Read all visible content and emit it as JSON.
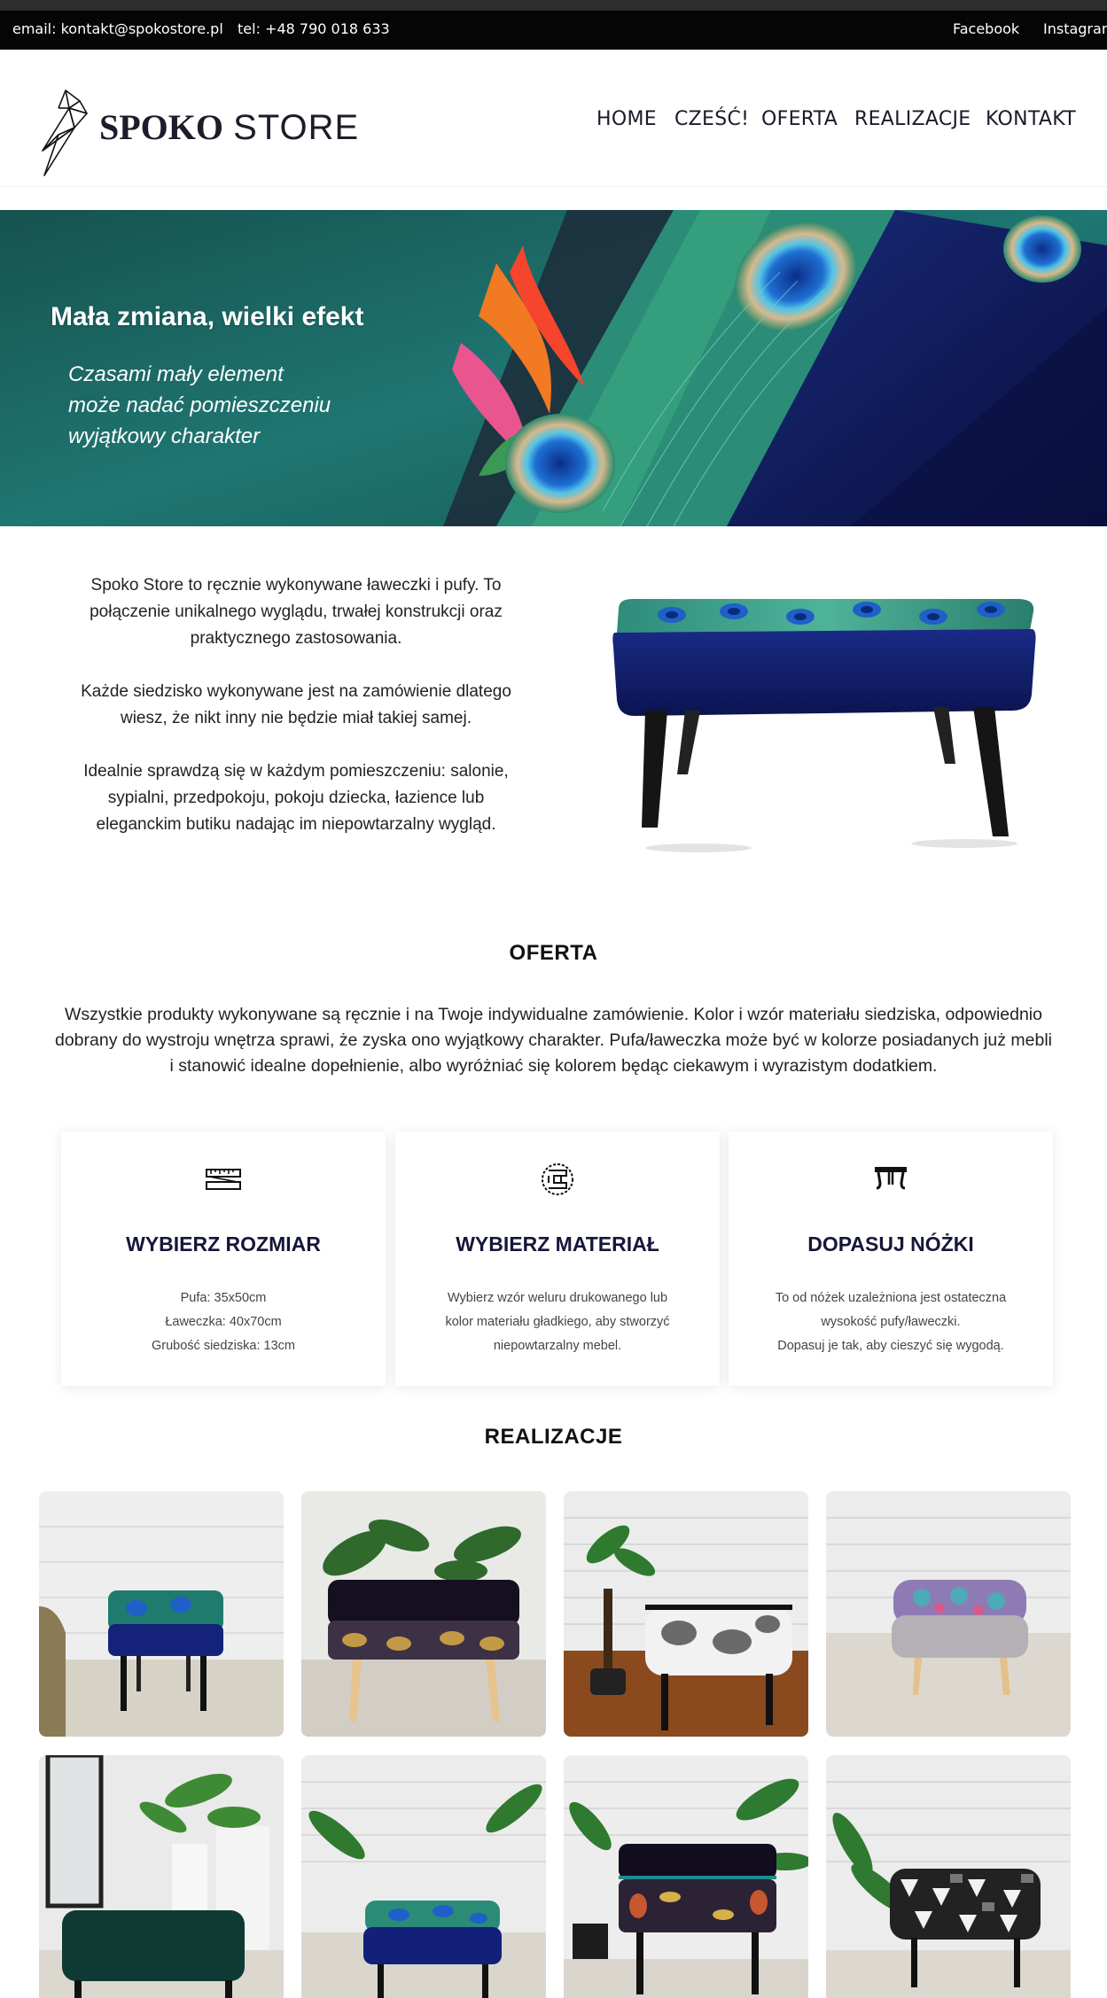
{
  "topbar": {
    "email": "email: kontakt@spokostore.pl",
    "phone": "tel: +48 790 018 633",
    "facebook": "Facebook",
    "instagram": "Instagram"
  },
  "header": {
    "logo_bold": "SPOKO",
    "logo_light": "STORE",
    "nav": [
      "HOME",
      "CZEŚĆ!",
      "OFERTA",
      "REALIZACJE",
      "KONTAKT"
    ]
  },
  "hero": {
    "title": "Mała zmiana, wielki efekt",
    "subtitle_lines": [
      "Czasami mały element",
      "może nadać pomieszczeniu",
      "wyjątkowy charakter"
    ]
  },
  "intro": {
    "paragraphs": [
      "Spoko Store to ręcznie wykonywane ławeczki i pufy. To połączenie unikalnego wyglądu, trwałej konstrukcji oraz praktycznego zastosowania.",
      "Każde siedzisko wykonywane jest na zamówienie dlatego wiesz, że nikt inny nie będzie miał takiej samej.",
      "Idealnie sprawdzą się w każdym pomieszczeniu: salonie, sypialni, przedpokoju, pokoju dziecka, łazience lub eleganckim butiku nadając im niepowtarzalny wygląd."
    ]
  },
  "offer": {
    "heading": "OFERTA",
    "text": "Wszystkie produkty wykonywane są ręcznie i na Twoje indywidualne zamówienie. Kolor i wzór materiału siedziska, odpowiednio dobrany do wystroju wnętrza sprawi, że zyska ono wyjątkowy charakter. Pufa/ławeczka może być w kolorze posiadanych już mebli i stanowić idealne dopełnienie, albo wyróżniać się kolorem będąc ciekawym i wyrazistym dodatkiem.",
    "cards": [
      {
        "title": "WYBIERZ ROZMIAR",
        "lines": [
          "Pufa: 35x50cm",
          "Ławeczka: 40x70cm",
          "Grubość siedziska: 13cm"
        ]
      },
      {
        "title": "WYBIERZ MATERIAŁ",
        "lines": [
          "Wybierz wzór weluru drukowanego lub",
          "kolor materiału gładkiego, aby stworzyć",
          "niepowtarzalny mebel."
        ]
      },
      {
        "title": "DOPASUJ NÓŻKI",
        "lines": [
          "To od nóżek uzależniona jest ostateczna",
          "wysokość pufy/ławeczki.",
          "Dopasuj je tak, aby cieszyć się wygodą."
        ]
      }
    ]
  },
  "gallery": {
    "heading": "REALIZACJE"
  },
  "colors": {
    "topbar": "#050505",
    "heading": "#16163a",
    "hero_teal": "#1e6664",
    "navy_velvet": "#101c63"
  }
}
